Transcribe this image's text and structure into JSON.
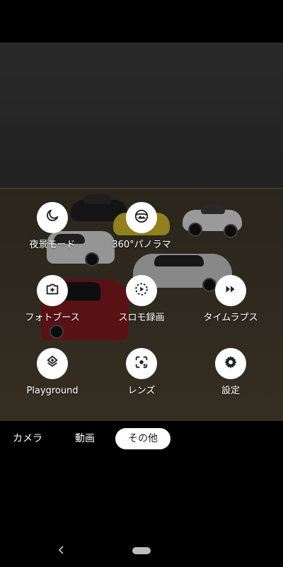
{
  "modes": [
    {
      "label": "夜景モード",
      "icon": "night-moon-icon"
    },
    {
      "label": "360°パノラマ",
      "icon": "panorama-icon"
    },
    {
      "label": "フォトブース",
      "icon": "photobooth-icon"
    },
    {
      "label": "スロモ録画",
      "icon": "slowmo-icon"
    },
    {
      "label": "タイムラプス",
      "icon": "timelapse-icon"
    },
    {
      "label": "Playground",
      "icon": "playground-icon"
    },
    {
      "label": "レンズ",
      "icon": "lens-icon"
    },
    {
      "label": "設定",
      "icon": "gear-icon"
    }
  ],
  "switcher": {
    "tabs": [
      "カメラ",
      "動画",
      "その他"
    ],
    "active": "その他"
  },
  "colors": {
    "background": "#000000",
    "mode_circle": "#ffffff",
    "icon": "#202124",
    "active_tab_bg": "#ffffff",
    "nav_pill": "#bdbdbd"
  }
}
